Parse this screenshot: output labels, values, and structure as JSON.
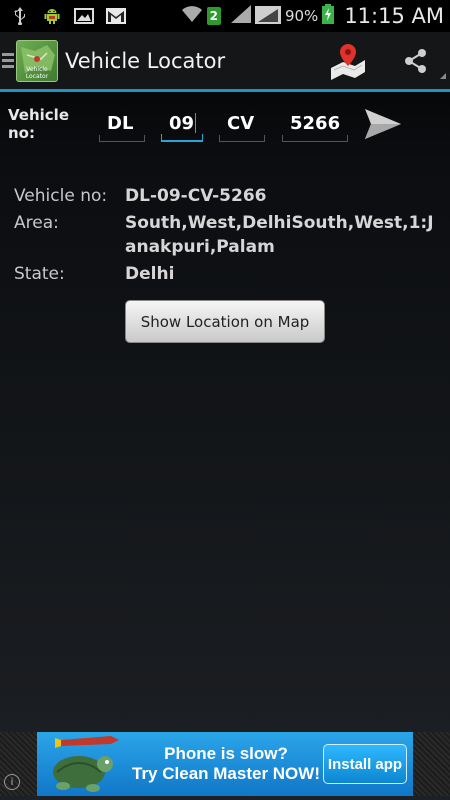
{
  "status_bar": {
    "icons": [
      "usb-icon",
      "android-debug-icon",
      "gallery-icon",
      "gmail-icon",
      "wifi-icon",
      "signal-icon"
    ],
    "notification_count": "2",
    "battery_percent": "90%",
    "time": "11:15 AM"
  },
  "action_bar": {
    "app_icon_caption": "Vehicle Locator",
    "title": "Vehicle Locator",
    "accent_color": "#1d94c4"
  },
  "input": {
    "label": "Vehicle no:",
    "state_code": "DL",
    "district_code": "09",
    "series": "CV",
    "number": "5266"
  },
  "details": {
    "vehicle_no_label": "Vehicle no:",
    "vehicle_no_value": "DL-09-CV-5266",
    "area_label": "Area:",
    "area_value": "South,West,DelhiSouth,West,1:Janakpuri,Palam",
    "state_label": "State:",
    "state_value": "Delhi"
  },
  "map_button_label": "Show Location on Map",
  "ad": {
    "headline": "Phone is slow?",
    "subline": "Try Clean Master NOW!",
    "cta": "Install app",
    "info_icon": "i"
  }
}
